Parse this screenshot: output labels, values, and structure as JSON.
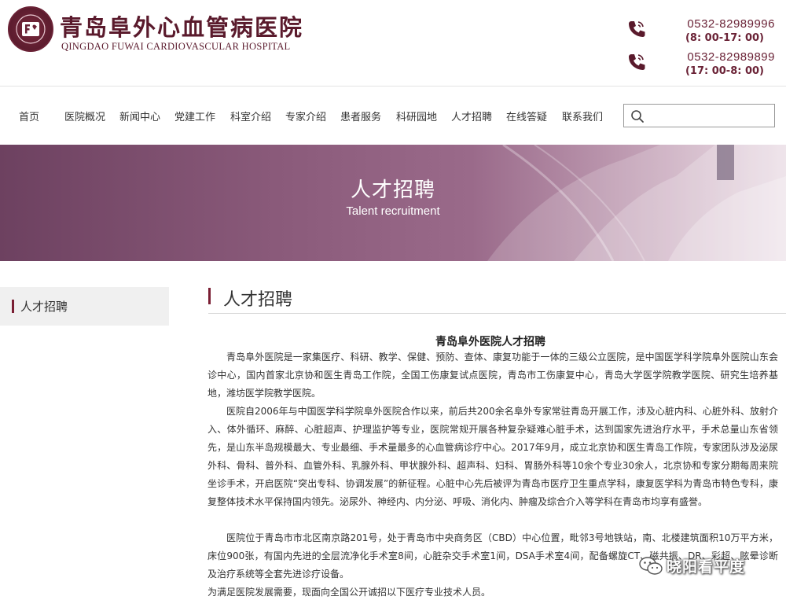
{
  "header": {
    "name_cn": "青岛阜外心血管病医院",
    "name_en": "QINGDAO FUWAI CARDIOVASCULAR HOSPITAL",
    "phones": [
      {
        "number": "0532-82989996",
        "hours": "(8: 00-17: 00)"
      },
      {
        "number": "0532-82989899",
        "hours": "(17: 00-8: 00)"
      }
    ]
  },
  "nav": {
    "items": [
      "首页",
      "医院概况",
      "新闻中心",
      "党建工作",
      "科室介绍",
      "专家介绍",
      "患者服务",
      "科研园地",
      "人才招聘",
      "在线答疑",
      "联系我们"
    ]
  },
  "search": {
    "placeholder": ""
  },
  "banner": {
    "title": "人才招聘",
    "subtitle": "Talent recruitment"
  },
  "sidebar": {
    "items": [
      {
        "label": "人才招聘"
      }
    ]
  },
  "main": {
    "title": "人才招聘",
    "article_title": "青岛阜外医院人才招聘",
    "paragraphs": [
      "青岛阜外医院是一家集医疗、科研、教学、保健、预防、查体、康复功能于一体的三级公立医院，是中国医学科学院阜外医院山东会诊中心，国内首家北京协和医生青岛工作院，全国工伤康复试点医院，青岛市工伤康复中心，青岛大学医学院教学医院、研究生培养基地，潍坊医学院教学医院。",
      "医院自2006年与中国医学科学院阜外医院合作以来，前后共200余名阜外专家常驻青岛开展工作，涉及心脏内科、心脏外科、放射介入、体外循环、麻醉、心脏超声、护理监护等专业，医院常规开展各种复杂疑难心脏手术，达到国家先进治疗水平，手术总量山东省领先，是山东半岛规模最大、专业最细、手术量最多的心血管病诊疗中心。2017年9月，成立北京协和医生青岛工作院，专家团队涉及泌尿外科、骨科、普外科、血管外科、乳腺外科、甲状腺外科、超声科、妇科、胃肠外科等10余个专业30余人，北京协和专家分期每周来院坐诊手术，开启医院“突出专科、协调发展”的新征程。心脏中心先后被评为青岛市医疗卫生重点学科，康复医学科为青岛市特色专科，康复整体技术水平保持国内领先。泌尿外、神经内、内分泌、呼吸、消化内、肿瘤及综合介入等学科在青岛市均享有盛誉。",
      "医院位于青岛市市北区南京路201号，处于青岛市中央商务区（CBD）中心位置，毗邻3号地铁站，南、北楼建筑面积10万平方米，床位900张，有国内先进的全层流净化手术室8间，心脏杂交手术室1间，DSA手术室4间，配备螺旋CT、磁共振、DR、彩超、眩晕诊断及治疗系统等全套先进诊疗设备。",
      "为满足医院发展需要，现面向全国公开诚招以下医疗专业技术人员。"
    ]
  },
  "watermark": {
    "text": "晓阳看平度",
    "icon": "wechat-icon"
  },
  "colors": {
    "brand": "#5a1a2c",
    "accent": "#7a1e33",
    "banner": "#8a5a7a"
  }
}
